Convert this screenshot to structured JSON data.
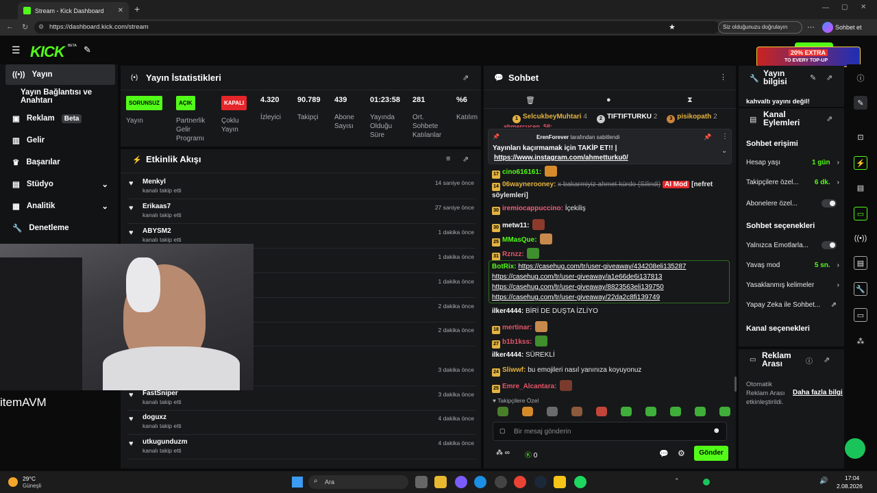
{
  "browser": {
    "tab_title": "Stream - Kick Dashboard",
    "url": "https://dashboard.kick.com/stream",
    "verify_label": "Siz olduğunuzu doğrulayın",
    "sohbet_label": "Sohbet et"
  },
  "header": {
    "logo": "KICK",
    "beta": "BETA",
    "ad_line1": "20% EXTRA",
    "ad_line2": "TO EVERY TOP-UP"
  },
  "sidebar": {
    "items": [
      {
        "label": "Yayın",
        "icon": "broadcast-icon"
      },
      {
        "label": "Yayın Bağlantısı ve Anahtarı",
        "icon": ""
      },
      {
        "label": "Reklam",
        "badge": "Beta",
        "icon": "ad-icon"
      },
      {
        "label": "Gelir",
        "icon": "income-icon"
      },
      {
        "label": "Başarılar",
        "icon": "trophy-icon"
      },
      {
        "label": "Stüdyo",
        "icon": "studio-icon"
      },
      {
        "label": "Analitik",
        "icon": "chart-icon"
      },
      {
        "label": "Denetleme",
        "icon": "wrench-icon"
      }
    ]
  },
  "stats": {
    "title": "Yayın İstatistikleri",
    "cols": [
      {
        "badge": "SORUNSUZ",
        "label": "Yayın"
      },
      {
        "badge": "AÇIK",
        "label": "Partnerlik Gelir Programı"
      },
      {
        "badge": "KAPALI",
        "label": "Çoklu Yayın"
      },
      {
        "value": "4.320",
        "label": "İzleyici"
      },
      {
        "value": "90.789",
        "label": "Takipçi"
      },
      {
        "value": "439",
        "label": "Abone Sayısı"
      },
      {
        "value": "01:23:58",
        "label": "Yayında Olduğu Süre"
      },
      {
        "value": "281",
        "label": "Ort. Sohbete Katılanlar"
      },
      {
        "value": "%6",
        "label": "Katılım"
      }
    ]
  },
  "activity": {
    "title": "Etkinlik Akışı",
    "rows": [
      {
        "name": "Menkyl",
        "sub": "kanalı takip etti",
        "time": "14 saniye önce"
      },
      {
        "name": "Erikaas7",
        "sub": "kanalı takip etti",
        "time": "27 saniye önce"
      },
      {
        "name": "ABYSM2",
        "sub": "kanalı takip etti",
        "time": "1 dakika önce"
      },
      {
        "name": "",
        "sub": "",
        "time": "1 dakika önce"
      },
      {
        "name": "",
        "sub": "",
        "time": "1 dakika önce"
      },
      {
        "name": "",
        "sub": "",
        "time": "2 dakika önce"
      },
      {
        "name": "",
        "sub": "",
        "time": "2 dakika önce"
      },
      {
        "name": "",
        "sub": "",
        "time": "3 dakika önce"
      },
      {
        "name": "FastSniper",
        "sub": "kanalı takip etti",
        "time": "3 dakika önce"
      },
      {
        "name": "doguxz",
        "sub": "kanalı takip etti",
        "time": "4 dakika önce"
      },
      {
        "name": "utkugunduzm",
        "sub": "kanalı takip etti",
        "time": "4 dakika önce"
      }
    ],
    "cam_brand": "itemAVM"
  },
  "chat": {
    "title": "Sohbet",
    "top_gifters": [
      {
        "rank": "1",
        "name": "SelcukbeyMuhtari",
        "count": "4"
      },
      {
        "rank": "2",
        "name": "TIFTIFTURKU",
        "count": "2"
      },
      {
        "rank": "3",
        "name": "pisikopath",
        "count": "2"
      }
    ],
    "pinned_by": "ErenForever",
    "pinned_by_suffix": "tarafından sabitlendi",
    "pinned_text": "Yayınları kaçırmamak için TAKİP ET!! |",
    "pinned_link": "https://www.instagram.com/ahmetturku0/",
    "partial_name": "ahmercucen_58:",
    "messages": [
      {
        "name": "cino616161:",
        "text": "",
        "color": "#53fc18",
        "badge": "17"
      },
      {
        "name": "06wayneroonеy:",
        "strike": "x bakarmiyiz ahmet kürdo (Silindi)",
        "tag": "AI Mod",
        "text": "[nefret söylemleri]",
        "color": "#e3b341",
        "badge": "14"
      },
      {
        "name": "iremiocappuccino:",
        "text": "İçekiliş",
        "color": "#f55d7a",
        "badge": "30"
      },
      {
        "name": "metw11:",
        "text": "",
        "color": "#fff",
        "badge": "30"
      },
      {
        "name": "MMasQue:",
        "text": "",
        "color": "#53fc18",
        "badge": "25"
      },
      {
        "name": "Rznzz:",
        "text": "",
        "color": "#e3566a",
        "badge": "31"
      },
      {
        "name": "BotRix:",
        "text": "https://casehug.com/tr/user-giveaway/434208eli135287",
        "color": "#53fc18"
      },
      {
        "name": "",
        "text": "https://casehug.com/tr/user-giveaway/a1e66de6i137813",
        "color": ""
      },
      {
        "name": "",
        "text": "https://casehug.com/tr/user-giveaway/8823563eli139750",
        "color": ""
      },
      {
        "name": "",
        "text": "https://casehug.com/tr/user-giveaway/22da2c8fi139749",
        "color": ""
      },
      {
        "name": "ilker4444:",
        "text": "BİRİ DE DUŞTA İZLİYO",
        "color": "#fff"
      },
      {
        "name": "mertinar:",
        "text": "",
        "color": "#e3566a",
        "badge": "18"
      },
      {
        "name": "b1b1kss:",
        "text": "",
        "color": "#e3566a",
        "badge": "27"
      },
      {
        "name": "ilker4444:",
        "text": "SÜREKLİ",
        "color": "#fff"
      },
      {
        "name": "Sliwwf:",
        "text": "bu emojileri nasıl yanınıza koyuyonuz",
        "color": "#e3b341",
        "badge": "24"
      },
      {
        "name": "Emre_Alcantara:",
        "text": "",
        "color": "#e3566a",
        "badge": "25"
      }
    ],
    "followers_only": "Takipçilere Özel",
    "input_placeholder": "Bir mesaj gönderin",
    "infinity": "∞",
    "points": "0",
    "send_button": "Gönder"
  },
  "stream_info": {
    "title": "Yayın bilgisi",
    "text": "kahvaltı yayını değil!"
  },
  "channel_actions": {
    "title": "Kanal Eylemleri",
    "chat_access": "Sohbet erişimi",
    "rows": [
      {
        "label": "Hesap yaşı",
        "value": "1 gün"
      },
      {
        "label": "Takipçilere özel...",
        "value": "6 dk."
      },
      {
        "label": "Abonelere özel...",
        "value": ""
      }
    ],
    "chat_options": "Sohbet seçenekleri",
    "rows2": [
      {
        "label": "Yalnızca Emotlarla...",
        "value": ""
      },
      {
        "label": "Yavaş mod",
        "value": "5 sn."
      },
      {
        "label": "Yasaklanmış kelimeler",
        "value": ""
      },
      {
        "label": "Yapay Zeka ile Sohbet...",
        "value": ""
      }
    ],
    "channel_options": "Kanal seçenekleri"
  },
  "ad_break": {
    "title": "Reklam Arası",
    "text": "Otomatik Reklam Arası etkinleştirildi.",
    "link": "Daha fazla bilgi"
  },
  "taskbar": {
    "weather_temp": "29°C",
    "weather_desc": "Güneşli",
    "search": "Ara",
    "time": "17:04",
    "date": "2.08.2026"
  },
  "colors": {
    "kick_green": "#53fc18",
    "panel": "#17181a",
    "bg": "#0b0b0c"
  }
}
